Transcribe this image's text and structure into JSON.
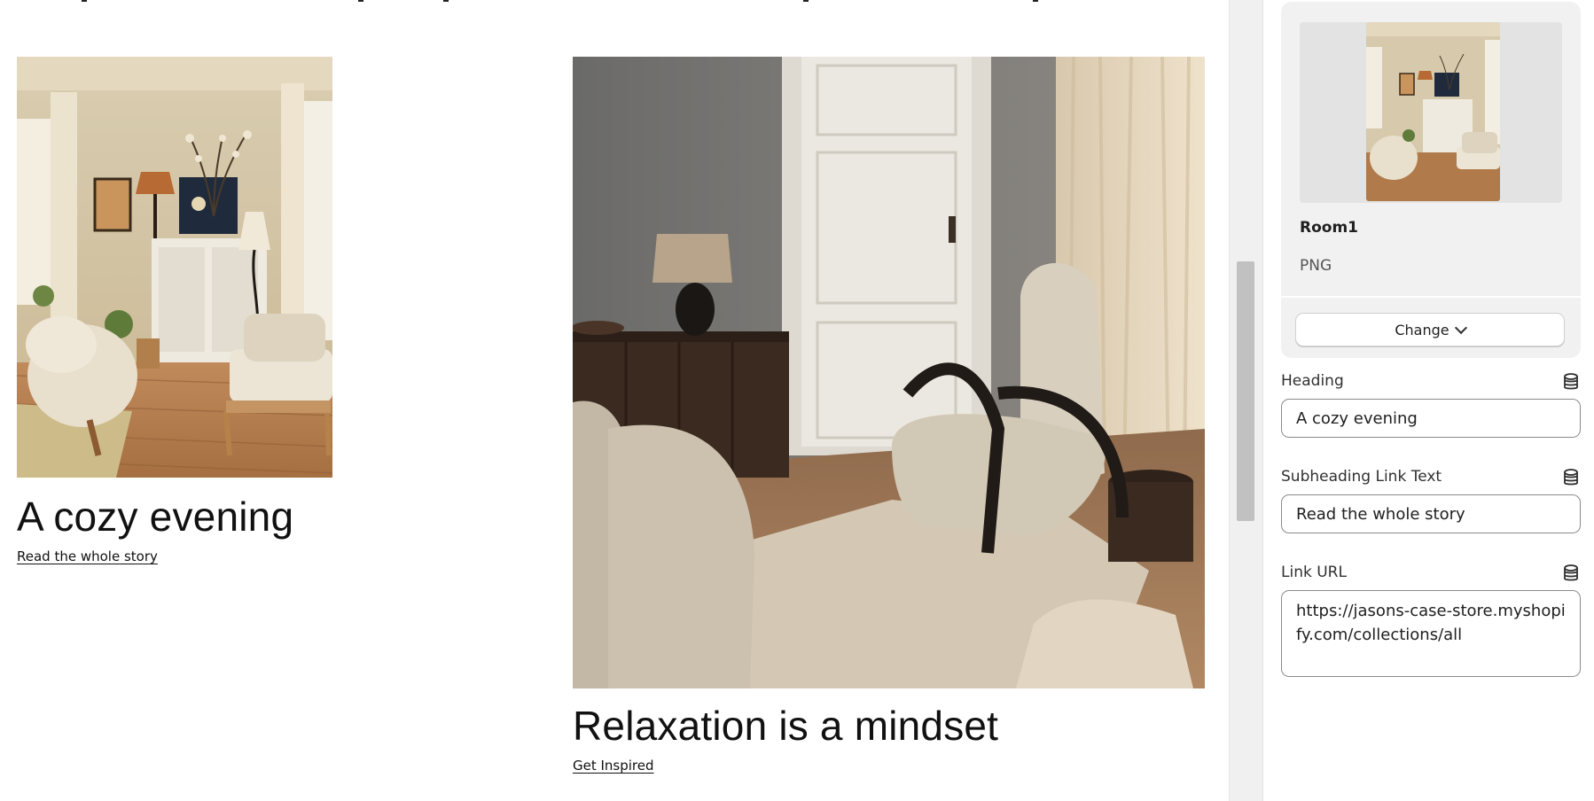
{
  "preview": {
    "blocks": [
      {
        "image_alt": "Living room with plants, white cabinet, lamp and rattan sofa",
        "heading": "A cozy evening",
        "link_text": "Read the whole story"
      },
      {
        "image_alt": "Bouclé armchair beside a white door with dark sideboard and lamp",
        "heading": "Relaxation is a mindset",
        "link_text": "Get Inspired"
      }
    ]
  },
  "panel": {
    "media": {
      "name": "Room1",
      "type": "PNG",
      "change_label": "Change"
    },
    "fields": {
      "heading": {
        "label": "Heading",
        "value": "A cozy evening"
      },
      "subheading": {
        "label": "Subheading Link Text",
        "value": "Read the whole story"
      },
      "link_url": {
        "label": "Link URL",
        "value": "https://jasons-case-store.myshopify.com/collections/all"
      }
    },
    "icons": {
      "dynamic_source": "database-icon",
      "change_chevron": "chevron-down-icon"
    }
  },
  "colors": {
    "panel_card": "#f1f1f1",
    "scrollbar_track": "#f0f0f0",
    "scrollbar_thumb": "#c1c1c1",
    "input_border": "#8a8a8a"
  }
}
